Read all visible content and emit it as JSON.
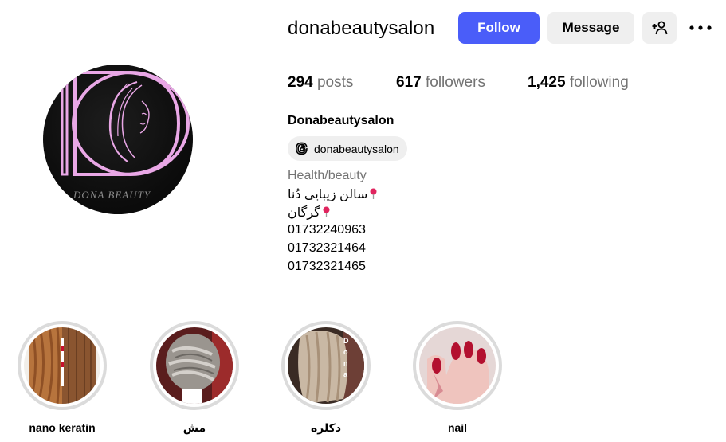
{
  "profile": {
    "username": "donabeautysalon",
    "full_name": "Donabeautysalon",
    "avatar_text": "DONA BEAUTY",
    "threads_handle": "donabeautysalon",
    "category": "Health/beauty",
    "bio_lines": [
      "سالن زیبایی دُنا",
      "گرگان",
      "01732240963",
      "01732321464",
      "01732321465"
    ]
  },
  "actions": {
    "follow_label": "Follow",
    "message_label": "Message"
  },
  "stats": {
    "posts_count": "294",
    "posts_label": "posts",
    "followers_count": "617",
    "followers_label": "followers",
    "following_count": "1,425",
    "following_label": "following"
  },
  "highlights": [
    {
      "label": "nano keratin"
    },
    {
      "label": "مش"
    },
    {
      "label": "دکلره"
    },
    {
      "label": "nail"
    }
  ],
  "colors": {
    "follow_bg": "#4a5df9",
    "secondary_btn_bg": "#efefef",
    "muted_text": "#737373",
    "logo_pink": "#e9a7e6"
  },
  "icons": {
    "add_user": "add-person-icon",
    "more": "more-horizontal-icon",
    "threads": "threads-icon",
    "pin": "pushpin-icon"
  }
}
